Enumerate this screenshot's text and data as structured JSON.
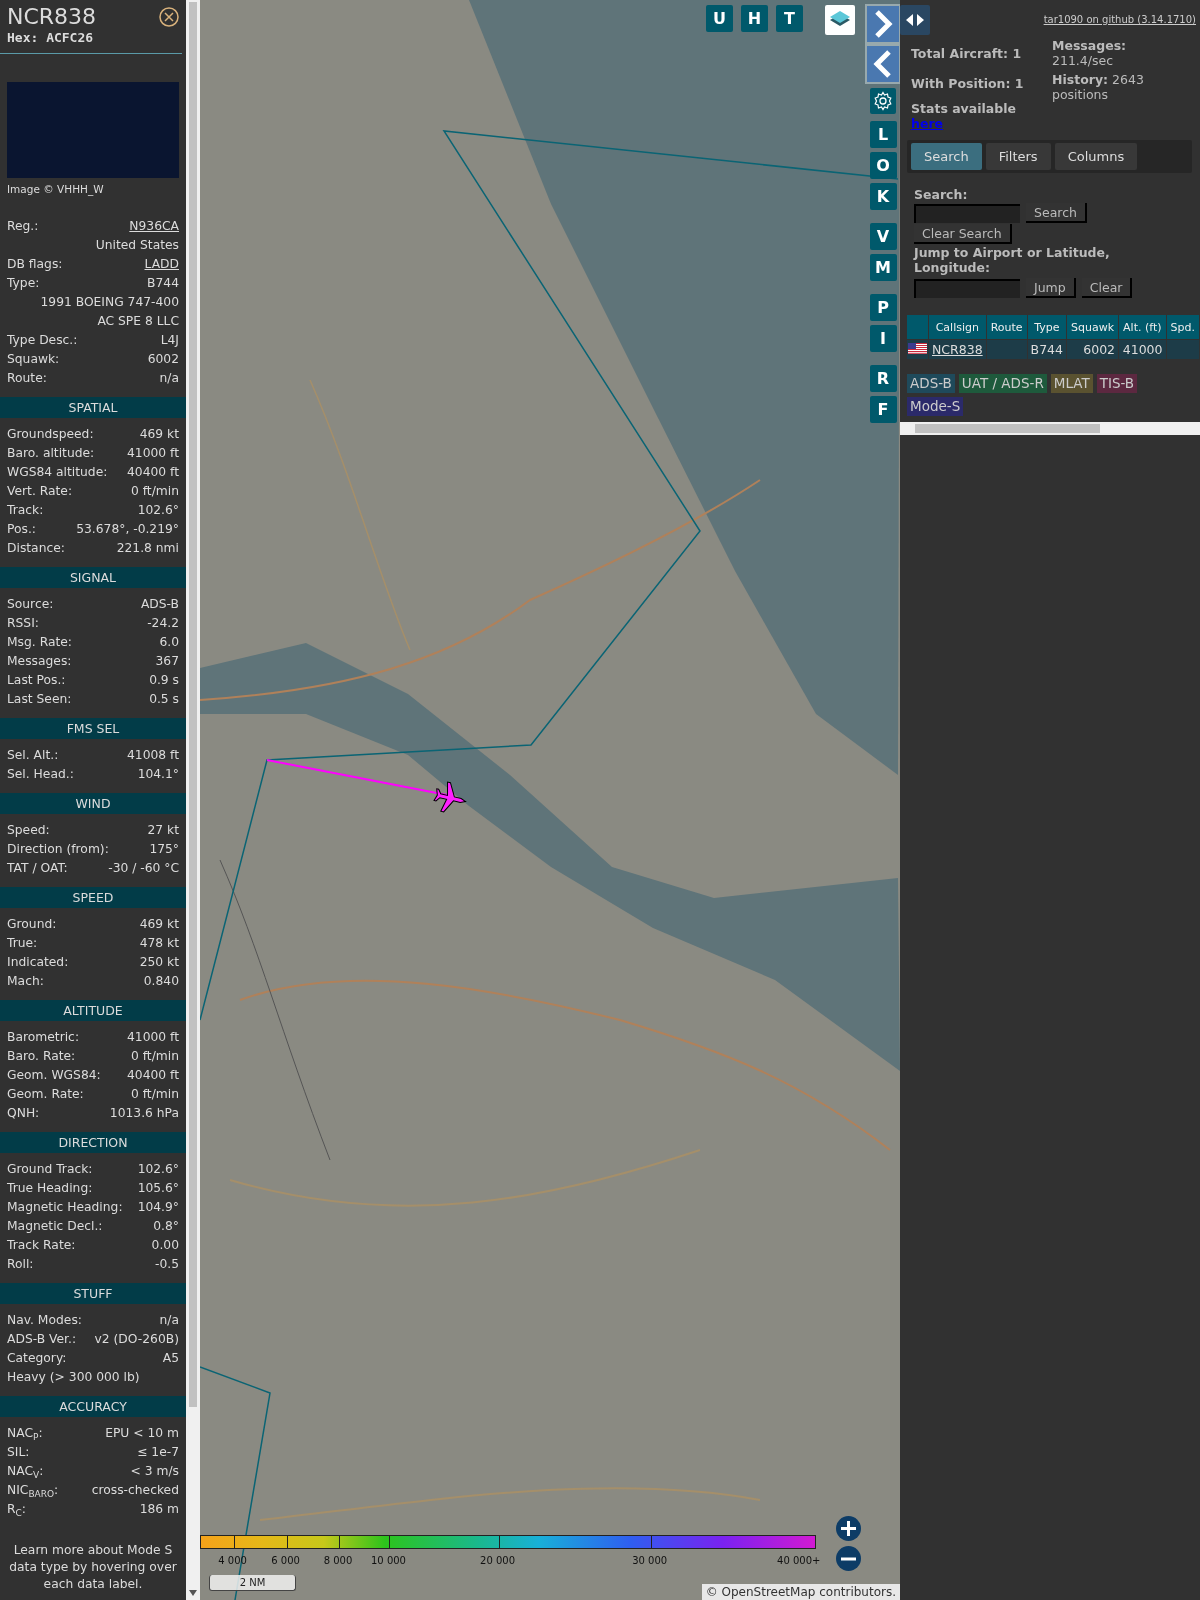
{
  "aircraft": {
    "callsign": "NCR838",
    "hex": "Hex: ACFC26",
    "photo_credit": "Image © VHHH_W",
    "rows": [
      {
        "kind": "link",
        "label": "Reg.:",
        "value": "N936CA"
      },
      {
        "kind": "value",
        "value": "United States"
      },
      {
        "kind": "link",
        "label": "DB flags:",
        "value": "LADD"
      },
      {
        "kind": "pair",
        "label": "Type:",
        "value": "B744"
      },
      {
        "kind": "value",
        "value": "1991 BOEING 747-400"
      },
      {
        "kind": "value",
        "value": "AC SPE 8 LLC"
      },
      {
        "kind": "pair",
        "label": "Type Desc.:",
        "value": "L4J"
      },
      {
        "kind": "pair",
        "label": "Squawk:",
        "value": "6002"
      },
      {
        "kind": "pair",
        "label": "Route:",
        "value": "n/a"
      }
    ]
  },
  "sections": [
    {
      "title": "SPATIAL",
      "rows": [
        {
          "kind": "pair",
          "label": "Groundspeed:",
          "value": "469 kt"
        },
        {
          "kind": "pair",
          "label": "Baro. altitude:",
          "value": "41000 ft"
        },
        {
          "kind": "pair",
          "label": "WGS84 altitude:",
          "value": "40400 ft"
        },
        {
          "kind": "pair",
          "label": "Vert. Rate:",
          "value": "0 ft/min"
        },
        {
          "kind": "pair",
          "label": "Track:",
          "value": "102.6°"
        },
        {
          "kind": "pair",
          "label": "Pos.:",
          "value": "53.678°, -0.219°"
        },
        {
          "kind": "pair",
          "label": "Distance:",
          "value": "221.8 nmi"
        }
      ]
    },
    {
      "title": "SIGNAL",
      "rows": [
        {
          "kind": "pair",
          "label": "Source:",
          "value": "ADS-B"
        },
        {
          "kind": "pair",
          "label": "RSSI:",
          "value": "-24.2"
        },
        {
          "kind": "pair",
          "label": "Msg. Rate:",
          "value": "6.0"
        },
        {
          "kind": "pair",
          "label": "Messages:",
          "value": "367"
        },
        {
          "kind": "pair",
          "label": "Last Pos.:",
          "value": "0.9 s"
        },
        {
          "kind": "pair",
          "label": "Last Seen:",
          "value": "0.5 s"
        }
      ]
    },
    {
      "title": "FMS SEL",
      "rows": [
        {
          "kind": "pair",
          "label": "Sel. Alt.:",
          "value": "41008 ft"
        },
        {
          "kind": "pair",
          "label": "Sel. Head.:",
          "value": "104.1°"
        }
      ]
    },
    {
      "title": "WIND",
      "rows": [
        {
          "kind": "pair",
          "label": "Speed:",
          "value": "27 kt"
        },
        {
          "kind": "pair",
          "label": "Direction (from):",
          "value": "175°"
        },
        {
          "kind": "pair",
          "label": "TAT / OAT:",
          "value": "-30 / -60 °C"
        }
      ]
    },
    {
      "title": "SPEED",
      "rows": [
        {
          "kind": "pair",
          "label": "Ground:",
          "value": "469 kt"
        },
        {
          "kind": "pair",
          "label": "True:",
          "value": "478 kt"
        },
        {
          "kind": "pair",
          "label": "Indicated:",
          "value": "250 kt"
        },
        {
          "kind": "pair",
          "label": "Mach:",
          "value": "0.840"
        }
      ]
    },
    {
      "title": "ALTITUDE",
      "rows": [
        {
          "kind": "pair",
          "label": "Barometric:",
          "value": "41000 ft"
        },
        {
          "kind": "pair",
          "label": "Baro. Rate:",
          "value": "0 ft/min"
        },
        {
          "kind": "pair",
          "label": "Geom. WGS84:",
          "value": "40400 ft"
        },
        {
          "kind": "pair",
          "label": "Geom. Rate:",
          "value": "0 ft/min"
        },
        {
          "kind": "pair",
          "label": "QNH:",
          "value": "1013.6 hPa"
        }
      ]
    },
    {
      "title": "DIRECTION",
      "rows": [
        {
          "kind": "pair",
          "label": "Ground Track:",
          "value": "102.6°"
        },
        {
          "kind": "pair",
          "label": "True Heading:",
          "value": "105.6°"
        },
        {
          "kind": "pair",
          "label": "Magnetic Heading:",
          "value": "104.9°"
        },
        {
          "kind": "pair",
          "label": "Magnetic Decl.:",
          "value": "0.8°"
        },
        {
          "kind": "pair",
          "label": "Track Rate:",
          "value": "0.00"
        },
        {
          "kind": "pair",
          "label": "Roll:",
          "value": "-0.5"
        }
      ]
    },
    {
      "title": "STUFF",
      "rows": [
        {
          "kind": "pair",
          "label": "Nav. Modes:",
          "value": "n/a"
        },
        {
          "kind": "pair",
          "label": "ADS-B Ver.:",
          "value": "v2 (DO-260B)"
        },
        {
          "kind": "pair",
          "label": "Category:",
          "value": "A5"
        },
        {
          "kind": "text",
          "value": "Heavy (> 300 000 lb)"
        }
      ]
    },
    {
      "title": "ACCURACY",
      "rows": [
        {
          "kind": "pair",
          "label": "NAC$_{P}$:",
          "value": "EPU < 10 m"
        },
        {
          "kind": "pair",
          "label": "SIL:",
          "value": "≤ 1e-7"
        },
        {
          "kind": "pair",
          "label": "NAC$_{V}$:",
          "value": "< 3 m/s"
        },
        {
          "kind": "pair",
          "label": "NIC$_{BARO}$:",
          "value": "cross-checked"
        },
        {
          "kind": "pair",
          "label": "R$_{C}$:",
          "value": "186 m"
        }
      ]
    }
  ],
  "note": "Learn more about Mode S data type by hovering over each data label.",
  "map": {
    "top_buttons": [
      "U",
      "H",
      "T"
    ],
    "side_groups": [
      [
        "L",
        "O",
        "K"
      ],
      [
        "V",
        "M"
      ],
      [
        "P",
        "I"
      ],
      [
        "R",
        "F"
      ]
    ],
    "legend_labels": [
      "4 000",
      "6 000",
      "8 000",
      "10 000",
      "20 000",
      "30 000",
      "40 000+"
    ],
    "scale": "2 NM",
    "attribution": "© OpenStreetMap contributors."
  },
  "side": {
    "version_link": "tar1090 on github (3.14.1710)",
    "stats": {
      "total": "Total Aircraft: 1",
      "with_position": "With Position: 1",
      "messages": "**Messages:** 211.4/sec",
      "history": "**History:** 2643 positions",
      "stats_text": "Stats available",
      "stats_link": "here"
    },
    "tabs": [
      {
        "label": "Search",
        "selected": true
      },
      {
        "label": "Filters",
        "selected": false
      },
      {
        "label": "Columns",
        "selected": false
      }
    ],
    "search": {
      "label": "Search:",
      "button": "Search",
      "clear_button": "Clear Search",
      "jump_label": "Jump to Airport or Latitude, Longitude:",
      "jump_button": "Jump",
      "jump_clear_button": "Clear"
    },
    "table": {
      "columns": [
        "Callsign",
        "Route",
        "Type",
        "Squawk",
        "Alt. (ft)",
        "Spd."
      ],
      "rows": [
        {
          "cells": [
            "NCR838",
            null,
            "B744",
            "6002",
            "41000",
            null
          ]
        }
      ]
    },
    "legend_badges": [
      {
        "label": "ADS-B",
        "color": "#1f4a5b"
      },
      {
        "label": "UAT / ADS-R",
        "color": "#1e5a3c"
      },
      {
        "label": "MLAT",
        "color": "#5a5230"
      },
      {
        "label": "TIS-B",
        "color": "#5c2840"
      },
      {
        "label": "Mode-S",
        "color": "#2b2a6a"
      }
    ]
  }
}
